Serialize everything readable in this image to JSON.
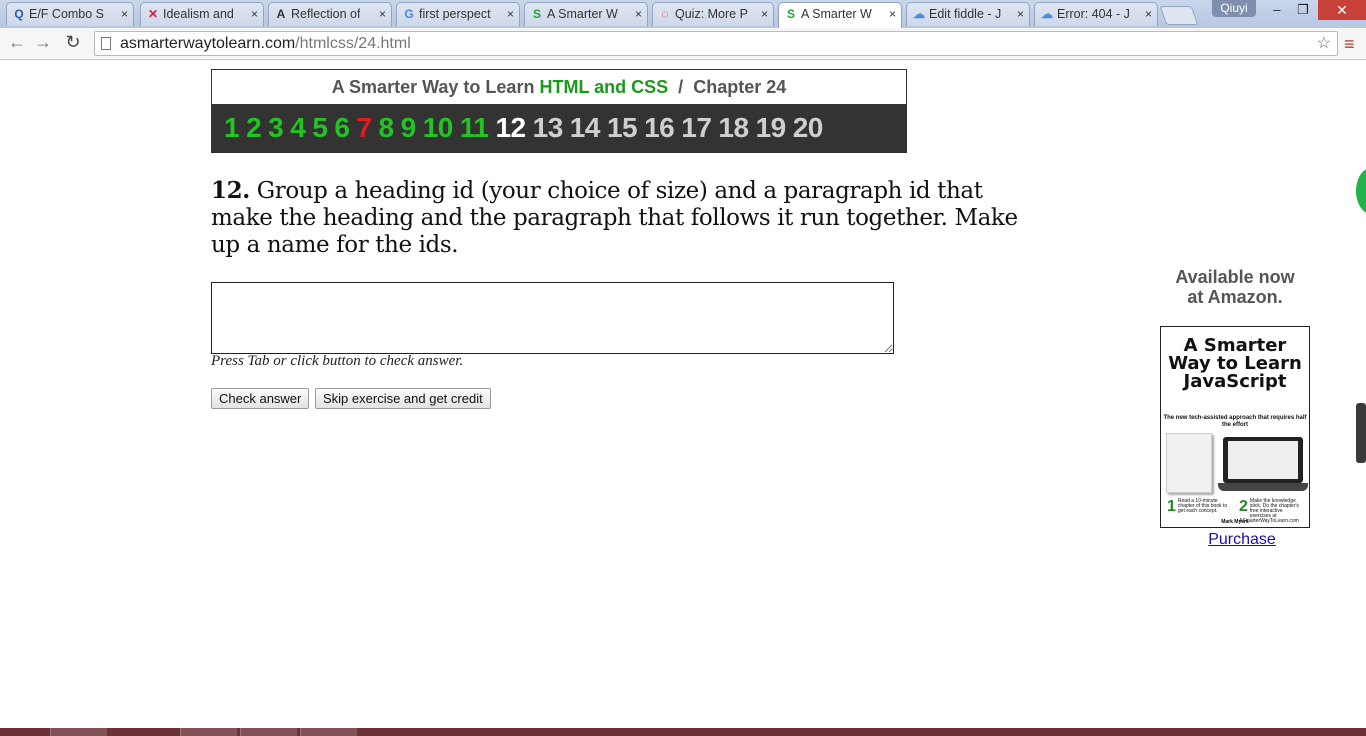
{
  "browser": {
    "tabs": [
      {
        "icon": "Q",
        "icon_color": "#2a5db0",
        "title": "E/F Combo S"
      },
      {
        "icon": "✕",
        "icon_color": "#d0223c",
        "title": "Idealism and"
      },
      {
        "icon": "A",
        "icon_color": "#333333",
        "title": "Reflection of"
      },
      {
        "icon": "G",
        "icon_color": "#4285f4",
        "title": "first perspect"
      },
      {
        "icon": "S",
        "icon_color": "#22a33a",
        "title": "A Smarter W"
      },
      {
        "icon": "◌",
        "icon_color": "#d0223c",
        "title": "Quiz: More P"
      },
      {
        "icon": "S",
        "icon_color": "#22a33a",
        "title": "A Smarter W"
      },
      {
        "icon": "☁",
        "icon_color": "#4a90d9",
        "title": "Edit fiddle - J"
      },
      {
        "icon": "☁",
        "icon_color": "#4a90d9",
        "title": "Error: 404 - J"
      }
    ],
    "profile_name": "Qiuyi",
    "url_host": "asmarterwaytolearn.com",
    "url_path": "/htmlcss/24.html"
  },
  "page": {
    "header_prefix": "A Smarter Way to Learn",
    "header_highlight": "HTML and CSS",
    "header_separator": "/",
    "header_chapter": "Chapter 24",
    "exercise_numbers": [
      {
        "label": "1",
        "status": "done"
      },
      {
        "label": "2",
        "status": "done"
      },
      {
        "label": "3",
        "status": "done"
      },
      {
        "label": "4",
        "status": "done"
      },
      {
        "label": "5",
        "status": "done"
      },
      {
        "label": "6",
        "status": "done"
      },
      {
        "label": "7",
        "status": "missed"
      },
      {
        "label": "8",
        "status": "done"
      },
      {
        "label": "9",
        "status": "done"
      },
      {
        "label": "10",
        "status": "done"
      },
      {
        "label": "11",
        "status": "done"
      },
      {
        "label": "12",
        "status": "current"
      },
      {
        "label": "13",
        "status": "todo"
      },
      {
        "label": "14",
        "status": "todo"
      },
      {
        "label": "15",
        "status": "todo"
      },
      {
        "label": "16",
        "status": "todo"
      },
      {
        "label": "17",
        "status": "todo"
      },
      {
        "label": "18",
        "status": "todo"
      },
      {
        "label": "19",
        "status": "todo"
      },
      {
        "label": "20",
        "status": "todo"
      }
    ],
    "question_number": "12.",
    "question_text": "Group a heading id (your choice of size) and a paragraph id that make the heading and the paragraph that follows it run together. Make up a name for the ids.",
    "answer_value": "",
    "hint": "Press Tab or click button to check answer.",
    "check_button": "Check answer",
    "skip_button": "Skip exercise and get credit"
  },
  "sidebar": {
    "line1": "Available now",
    "line2": "at Amazon.",
    "book_title": "A Smarter Way to Learn JavaScript",
    "book_subtitle": "The new tech-assisted approach that requires half the effort",
    "book_step1": "Read a 10-minute chapter of this book to get each concept.",
    "book_step2": "Make the knowledge stick. Do the chapter's free interactive exercises at ASmarterWayToLearn.com",
    "book_author": "Mark Myers",
    "purchase_link": "Purchase"
  },
  "colors": {
    "done": "#22c422",
    "missed": "#e31b1b",
    "current": "#ffffff",
    "todo": "#cfcfcf",
    "header_green": "#1a9a1a",
    "link": "#1a0dab"
  }
}
